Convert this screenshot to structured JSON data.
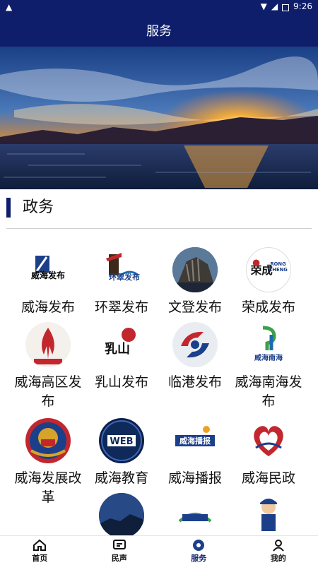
{
  "status_bar": {
    "time": "9:26"
  },
  "header": {
    "title": "服务"
  },
  "section": {
    "title": "政务"
  },
  "services": [
    {
      "label": "威海发布",
      "logo_text": "威海发布"
    },
    {
      "label": "环翠发布",
      "logo_text": "环翠发布"
    },
    {
      "label": "文登发布",
      "logo_text": ""
    },
    {
      "label": "荣成发布",
      "logo_text": "荣成"
    },
    {
      "label": "威海高区发布",
      "logo_text": ""
    },
    {
      "label": "乳山发布",
      "logo_text": "乳山"
    },
    {
      "label": "临港发布",
      "logo_text": ""
    },
    {
      "label": "威海南海发布",
      "logo_text": "威海南海"
    },
    {
      "label": "威海发展改革",
      "logo_text": ""
    },
    {
      "label": "威海教育",
      "logo_text": "WEB"
    },
    {
      "label": "威海播报",
      "logo_text": "威海播报"
    },
    {
      "label": "威海民政",
      "logo_text": ""
    }
  ],
  "tabs": [
    {
      "label": "首页",
      "icon": "home-icon"
    },
    {
      "label": "民声",
      "icon": "message-icon"
    },
    {
      "label": "服务",
      "icon": "service-icon"
    },
    {
      "label": "我的",
      "icon": "user-icon"
    }
  ],
  "colors": {
    "primary": "#0f1e6b",
    "text": "#111111"
  }
}
